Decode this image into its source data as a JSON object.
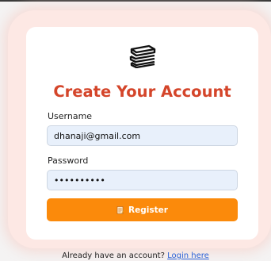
{
  "form": {
    "title": "Create Your Account",
    "logo_icon": "books-icon",
    "username_label": "Username",
    "username_value": "dhanaji@gmail.com",
    "password_label": "Password",
    "password_value": "dhanaji123",
    "register_label": "Register",
    "register_icon": "memo-icon"
  },
  "footer": {
    "prompt": "Already have an account?",
    "link": "Login here"
  },
  "colors": {
    "accent": "#d4452a",
    "button": "#fb8a0b",
    "input_bg": "#e8f0fb",
    "link": "#2b61d6"
  }
}
